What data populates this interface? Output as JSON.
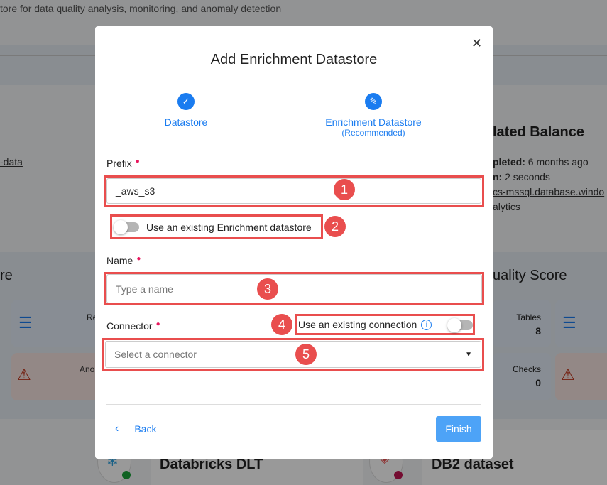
{
  "background": {
    "subtitle": "tore for data quality analysis, monitoring, and anomaly detection",
    "left_link": "-data",
    "right_title": "lated Balance",
    "completed_label": "pleted:",
    "completed_value": "6 months ago",
    "duration_label": "n:",
    "duration_value": "2 seconds",
    "host": "cs-mssql.database.windo",
    "team": "alytics",
    "left_section": "re",
    "right_section": "uality Score",
    "card_records": "Re",
    "card_anomalies": "Ano",
    "tables_label": "Tables",
    "tables_value": "8",
    "checks_label": "Checks",
    "checks_value": "0",
    "datastore_1": "Databricks DLT",
    "datastore_2": "DB2 dataset"
  },
  "modal": {
    "title": "Add Enrichment Datastore",
    "close_icon": "close-icon",
    "steps": [
      {
        "label": "Datastore",
        "icon": "check-icon"
      },
      {
        "label": "Enrichment Datastore",
        "sublabel": "(Recommended)",
        "icon": "pencil-icon"
      }
    ],
    "prefix": {
      "label": "Prefix",
      "value": "_aws_s3"
    },
    "existing_enrichment_toggle": {
      "label": "Use an existing Enrichment datastore",
      "on": false
    },
    "name": {
      "label": "Name",
      "placeholder": "Type a name"
    },
    "connector": {
      "label": "Connector",
      "placeholder": "Select a connector"
    },
    "existing_connection_toggle": {
      "label": "Use an existing connection",
      "on": false
    },
    "back_label": "Back",
    "finish_label": "Finish"
  },
  "annotations": [
    "1",
    "2",
    "3",
    "4",
    "5"
  ],
  "colors": {
    "accent": "#1a7cf0",
    "highlight": "#e94e4e",
    "required": "#e8175d"
  }
}
